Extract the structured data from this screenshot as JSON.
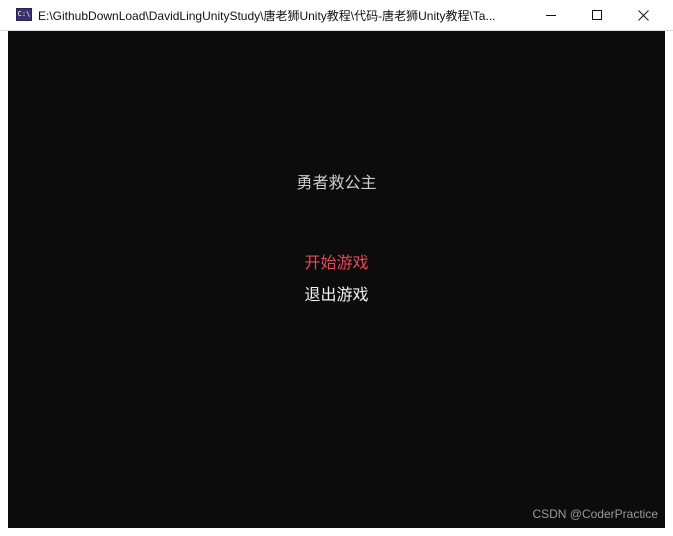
{
  "window": {
    "title": "E:\\GithubDownLoad\\DavidLingUnityStudy\\唐老狮Unity教程\\代码-唐老狮Unity教程\\Ta...",
    "app_icon_text": "C:\\"
  },
  "console": {
    "game_title": "勇者救公主",
    "menu": {
      "start_label": "开始游戏",
      "quit_label": "退出游戏",
      "selected": "开始游戏"
    }
  },
  "watermark": {
    "text": "CSDN @CoderPractice"
  },
  "colors": {
    "console_background": "#0c0c0c",
    "title_text": "#cccccc",
    "selected_menu_text": "#e74856",
    "menu_text": "#f2f2f2"
  },
  "icons": {
    "app": "console-app-icon",
    "minimize": "minimize-icon",
    "maximize": "maximize-icon",
    "close": "close-icon"
  }
}
